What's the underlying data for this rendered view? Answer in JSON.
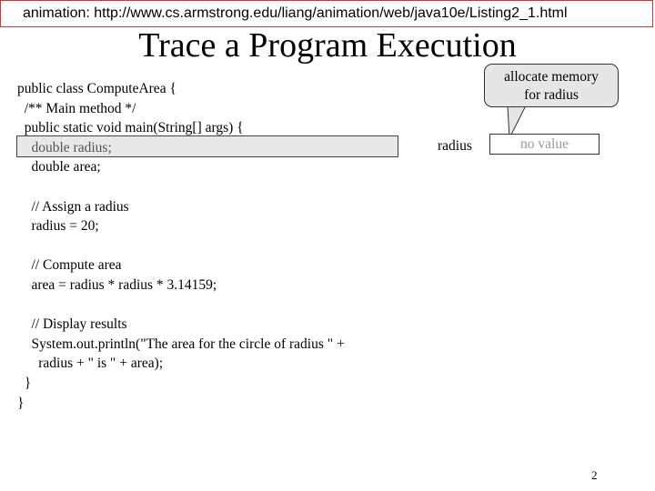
{
  "link_bar": {
    "text": "animation: http://www.cs.armstrong.edu/liang/animation/web/java10e/Listing2_1.html"
  },
  "title": "Trace a Program Execution",
  "code_lines": [
    "public class ComputeArea {",
    "  /** Main method */",
    "  public static void main(String[] args) {",
    "    double radius;",
    "    double area;",
    "",
    "    // Assign a radius",
    "    radius = 20;",
    "",
    "    // Compute area",
    "    area = radius * radius * 3.14159;",
    "",
    "    // Display results",
    "    System.out.println(\"The area for the circle of radius \" +",
    "      radius + \" is \" + area);",
    "  }",
    "}"
  ],
  "highlighted_line_index": 3,
  "callout": {
    "line1": "allocate memory",
    "line2": "for radius"
  },
  "variable": {
    "name": "radius",
    "value": "no value"
  },
  "page_number": "2"
}
